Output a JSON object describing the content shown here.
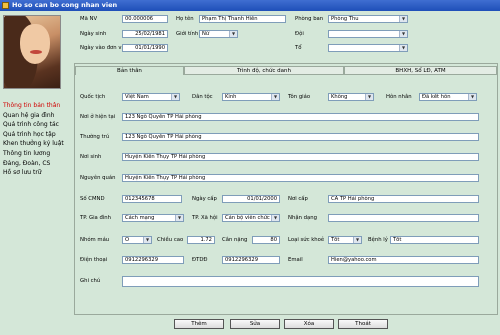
{
  "window": {
    "title": "Ho so can bo cong nhan vien"
  },
  "header": {
    "ma_nv": {
      "label": "Mã NV",
      "value": "00.000006"
    },
    "ho_ten": {
      "label": "Họ tên",
      "value": "Phạm Thị Thanh Hiền"
    },
    "phong_ban": {
      "label": "Phòng ban",
      "value": "Phòng Thu"
    },
    "ngay_sinh": {
      "label": "Ngày sinh",
      "value": "25/02/1981"
    },
    "gioi_tinh": {
      "label": "Giới tính",
      "value": "Nữ"
    },
    "doi": {
      "label": "Đội",
      "value": ""
    },
    "ngay_vao": {
      "label": "Ngày vào đơn vị",
      "value": "01/01/1990"
    },
    "to": {
      "label": "Tổ",
      "value": ""
    }
  },
  "sidebar": {
    "items": [
      {
        "label": "Thông tin bản thân"
      },
      {
        "label": "Quan hệ gia đình"
      },
      {
        "label": "Quá trình công tác"
      },
      {
        "label": "Quá trình học tập"
      },
      {
        "label": "Khen thưởng kỷ luật"
      },
      {
        "label": "Thông tin lương"
      },
      {
        "label": "Đảng, Đoàn, CS"
      },
      {
        "label": "Hồ sơ lưu trữ"
      }
    ]
  },
  "tabs": [
    {
      "label": "Bản thân"
    },
    {
      "label": "Trình độ, chức danh"
    },
    {
      "label": "BHXH, Sổ LĐ, ATM"
    }
  ],
  "form": {
    "quoc_tich": {
      "label": "Quốc tịch",
      "value": "Việt Nam"
    },
    "dan_toc": {
      "label": "Dân tộc",
      "value": "Kinh"
    },
    "ton_giao": {
      "label": "Tôn giáo",
      "value": "Không"
    },
    "hon_nhan": {
      "label": "Hôn nhân",
      "value": "Đã kết hôn"
    },
    "noi_o": {
      "label": "Nơi ở hiện tại",
      "value": "123 Ngô Quyền TP Hải phòng"
    },
    "thuong_tru": {
      "label": "Thường trú",
      "value": "123 Ngô Quyền TP Hải phòng"
    },
    "noi_sinh": {
      "label": "Nơi sinh",
      "value": "Huyện Kiến Thụy TP Hải phòng"
    },
    "nguyen_quan": {
      "label": "Nguyên quán",
      "value": "Huyện Kiến Thụy TP Hải phòng"
    },
    "so_cmnd": {
      "label": "Số CMND",
      "value": "012345678"
    },
    "ngay_cap": {
      "label": "Ngày cấp",
      "value": "01/01/2000"
    },
    "noi_cap": {
      "label": "Nơi cấp",
      "value": "CA TP Hải phòng"
    },
    "gia_dinh": {
      "label": "TP. Gia đình",
      "value": "Cách mạng"
    },
    "xa_hoi": {
      "label": "TP. Xã hội",
      "value": "Cán bộ viên chức"
    },
    "nhan_dang": {
      "label": "Nhận dạng",
      "value": ""
    },
    "nhom_mau": {
      "label": "Nhóm máu",
      "value": "O"
    },
    "chieu_cao": {
      "label": "Chiều cao",
      "value": "1.72"
    },
    "can_nang": {
      "label": "Cân nặng",
      "value": "80"
    },
    "suc_khoe": {
      "label": "Loại sức khoẻ",
      "value": "Tốt"
    },
    "benh_ly": {
      "label": "Bệnh lý",
      "value": "Tốt"
    },
    "dien_thoai": {
      "label": "Điện thoại",
      "value": "0912296329"
    },
    "dtdd": {
      "label": "ĐTDĐ",
      "value": "0912296329"
    },
    "email": {
      "label": "Email",
      "value": "Hien@yahoo.com"
    },
    "ghi_chu": {
      "label": "Ghi chú",
      "value": ""
    }
  },
  "buttons": {
    "add": "Thêm",
    "edit": "Sửa",
    "delete": "Xóa",
    "exit": "Thoát"
  }
}
